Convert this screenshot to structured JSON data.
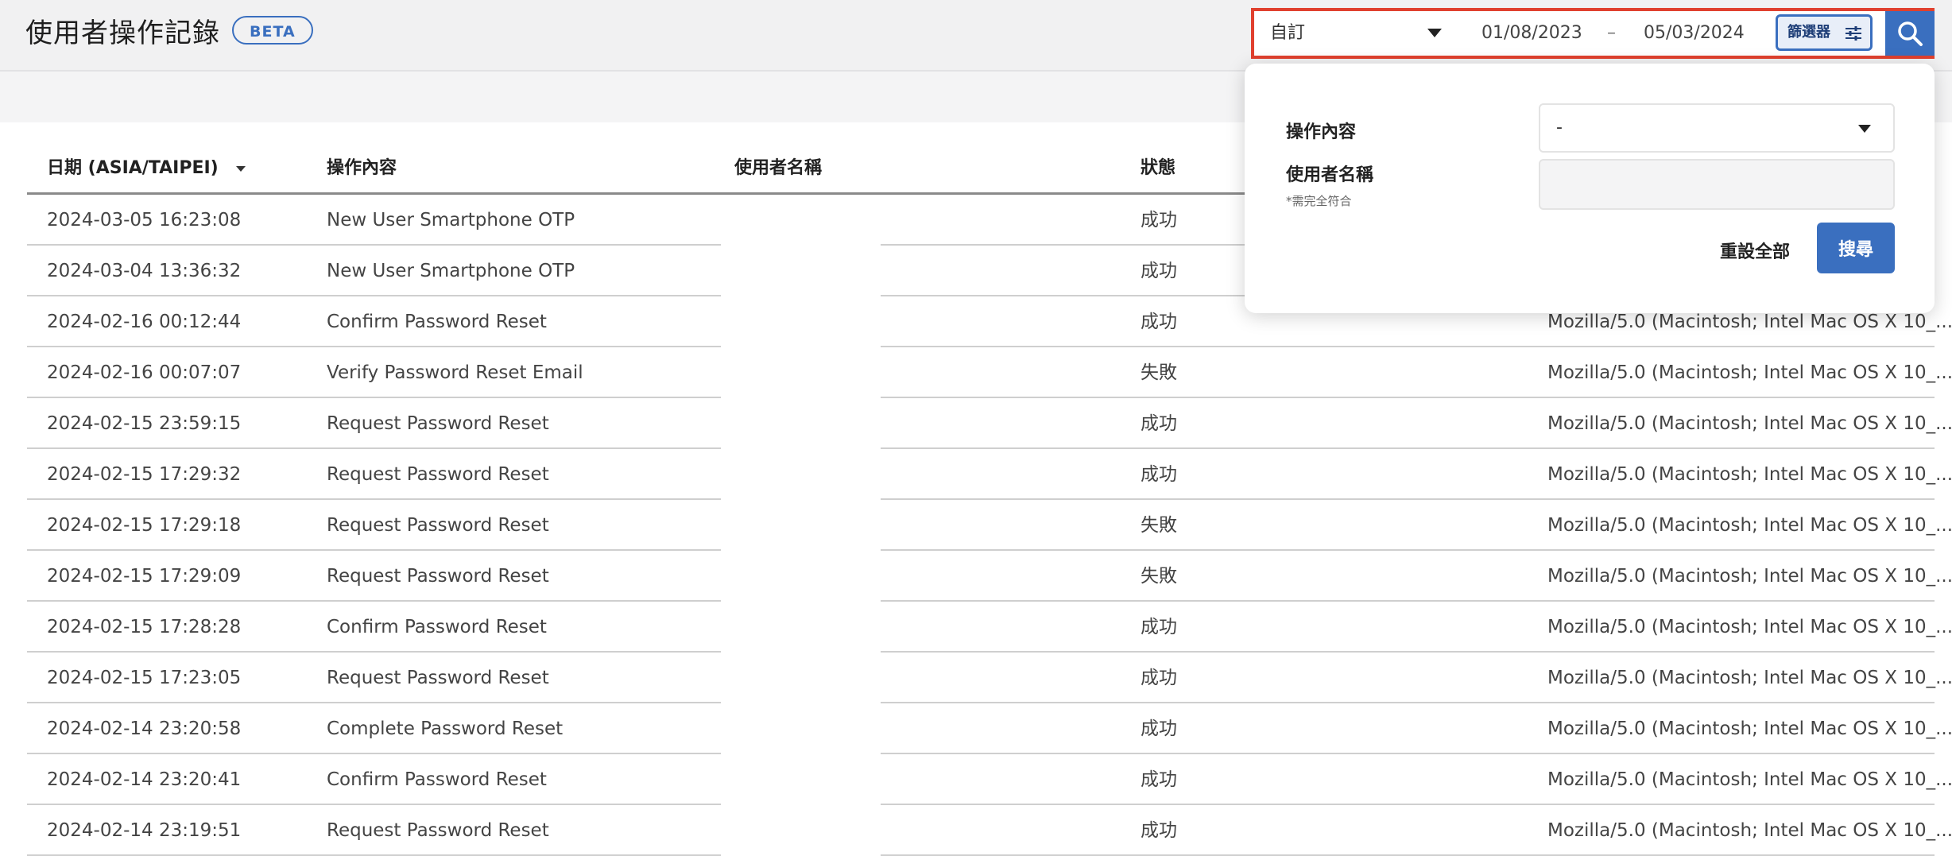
{
  "header": {
    "title": "使用者操作記錄",
    "badge": "BETA"
  },
  "filter_bar": {
    "range_option": "自訂",
    "date_from": "01/08/2023",
    "date_separator": "–",
    "date_to": "05/03/2024",
    "filter_label": "篩選器",
    "accent_color": "#3a6fbf",
    "highlight_color": "#e0402e"
  },
  "filter_panel": {
    "action_label": "操作內容",
    "action_value": "-",
    "username_label": "使用者名稱",
    "username_note": "*需完全符合",
    "username_value": "",
    "reset_label": "重設全部",
    "search_label": "搜尋"
  },
  "table": {
    "columns": [
      "日期 (ASIA/TAIPEI)",
      "操作內容",
      "使用者名稱",
      "狀態"
    ],
    "rows": [
      {
        "date": "2024-03-05 16:23:08",
        "action": "New User Smartphone OTP",
        "user": "",
        "status": "成功",
        "agent": ""
      },
      {
        "date": "2024-03-04 13:36:32",
        "action": "New User Smartphone OTP",
        "user": "",
        "status": "成功",
        "agent": ""
      },
      {
        "date": "2024-02-16 00:12:44",
        "action": "Confirm Password Reset",
        "user": "",
        "status": "成功",
        "agent": "Mozilla/5.0 (Macintosh; Intel Mac OS X 10_..."
      },
      {
        "date": "2024-02-16 00:07:07",
        "action": "Verify Password Reset Email",
        "user": "",
        "status": "失敗",
        "agent": "Mozilla/5.0 (Macintosh; Intel Mac OS X 10_..."
      },
      {
        "date": "2024-02-15 23:59:15",
        "action": "Request Password Reset",
        "user": "",
        "status": "成功",
        "agent": "Mozilla/5.0 (Macintosh; Intel Mac OS X 10_..."
      },
      {
        "date": "2024-02-15 17:29:32",
        "action": "Request Password Reset",
        "user": "",
        "status": "成功",
        "agent": "Mozilla/5.0 (Macintosh; Intel Mac OS X 10_..."
      },
      {
        "date": "2024-02-15 17:29:18",
        "action": "Request Password Reset",
        "user": "",
        "status": "失敗",
        "agent": "Mozilla/5.0 (Macintosh; Intel Mac OS X 10_..."
      },
      {
        "date": "2024-02-15 17:29:09",
        "action": "Request Password Reset",
        "user": "",
        "status": "失敗",
        "agent": "Mozilla/5.0 (Macintosh; Intel Mac OS X 10_..."
      },
      {
        "date": "2024-02-15 17:28:28",
        "action": "Confirm Password Reset",
        "user": "",
        "status": "成功",
        "agent": "Mozilla/5.0 (Macintosh; Intel Mac OS X 10_..."
      },
      {
        "date": "2024-02-15 17:23:05",
        "action": "Request Password Reset",
        "user": "",
        "status": "成功",
        "agent": "Mozilla/5.0 (Macintosh; Intel Mac OS X 10_..."
      },
      {
        "date": "2024-02-14 23:20:58",
        "action": "Complete Password Reset",
        "user": "",
        "status": "成功",
        "agent": "Mozilla/5.0 (Macintosh; Intel Mac OS X 10_..."
      },
      {
        "date": "2024-02-14 23:20:41",
        "action": "Confirm Password Reset",
        "user": "",
        "status": "成功",
        "agent": "Mozilla/5.0 (Macintosh; Intel Mac OS X 10_..."
      },
      {
        "date": "2024-02-14 23:19:51",
        "action": "Request Password Reset",
        "user": "",
        "status": "成功",
        "agent": "Mozilla/5.0 (Macintosh; Intel Mac OS X 10_..."
      }
    ]
  }
}
